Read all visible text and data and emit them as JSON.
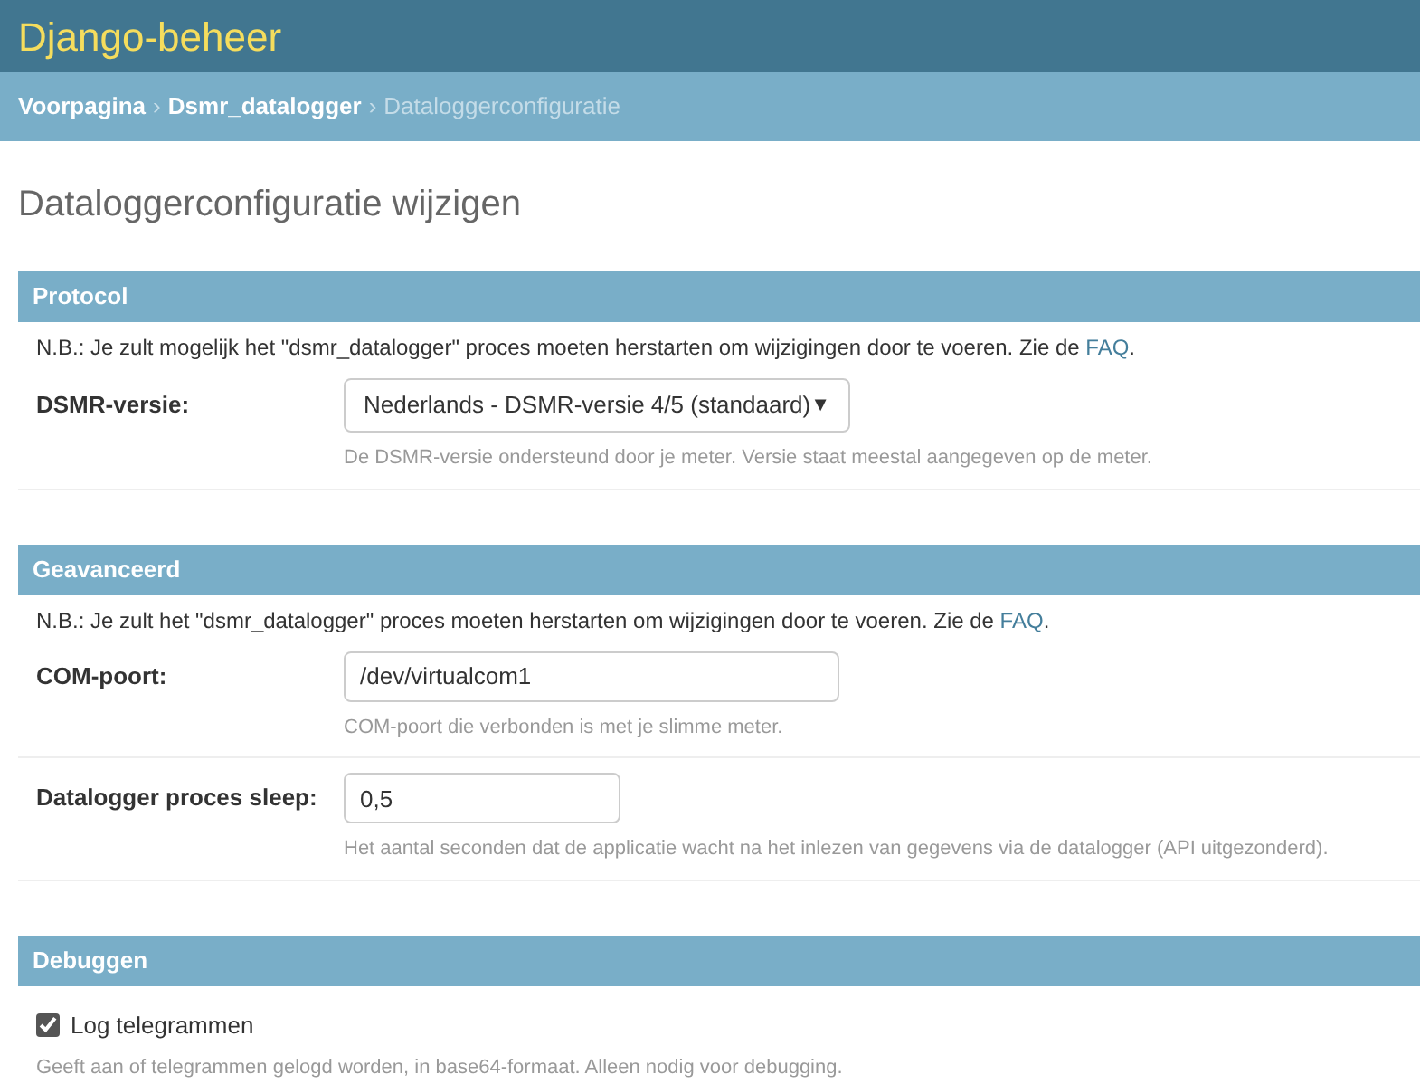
{
  "header": {
    "title": "Django-beheer"
  },
  "breadcrumb_separator": "›",
  "breadcrumbs": [
    {
      "label": "Voorpagina",
      "current": false
    },
    {
      "label": "Dsmr_datalogger",
      "current": false
    },
    {
      "label": "Dataloggerconfiguratie",
      "current": true
    }
  ],
  "heading": "Dataloggerconfiguratie wijzigen",
  "fieldsets": [
    {
      "title": "Protocol",
      "note": {
        "text": "N.B.: Je zult mogelijk het \"dsmr_datalogger\" proces moeten herstarten om wijzigingen door te voeren. Zie de ",
        "link": "FAQ",
        "end": "."
      },
      "fields": [
        {
          "kind": "select",
          "label": "DSMR-versie:",
          "value": "Nederlands - DSMR-versie 4/5 (standaard)",
          "arrow": "▼",
          "help": "De DSMR-versie ondersteund door je meter. Versie staat meestal aangegeven op de meter."
        }
      ]
    },
    {
      "title": "Geavanceerd",
      "note": {
        "text": "N.B.: Je zult het \"dsmr_datalogger\" proces moeten herstarten om wijzigingen door te voeren. Zie de ",
        "link": "FAQ",
        "end": "."
      },
      "fields": [
        {
          "kind": "text",
          "label": "COM-poort:",
          "value": "/dev/virtualcom1",
          "help": "COM-poort die verbonden is met je slimme meter."
        },
        {
          "kind": "number",
          "label": "Datalogger proces sleep:",
          "value": "0,5",
          "help": "Het aantal seconden dat de applicatie wacht na het inlezen van gegevens via de datalogger (API uitgezonderd)."
        }
      ]
    },
    {
      "title": "Debuggen",
      "fields": [
        {
          "kind": "checkbox",
          "label": "Log telegrammen",
          "checked": true,
          "help": "Geeft aan of telegrammen gelogd worden, in base64-formaat. Alleen nodig voor debugging."
        }
      ]
    }
  ]
}
